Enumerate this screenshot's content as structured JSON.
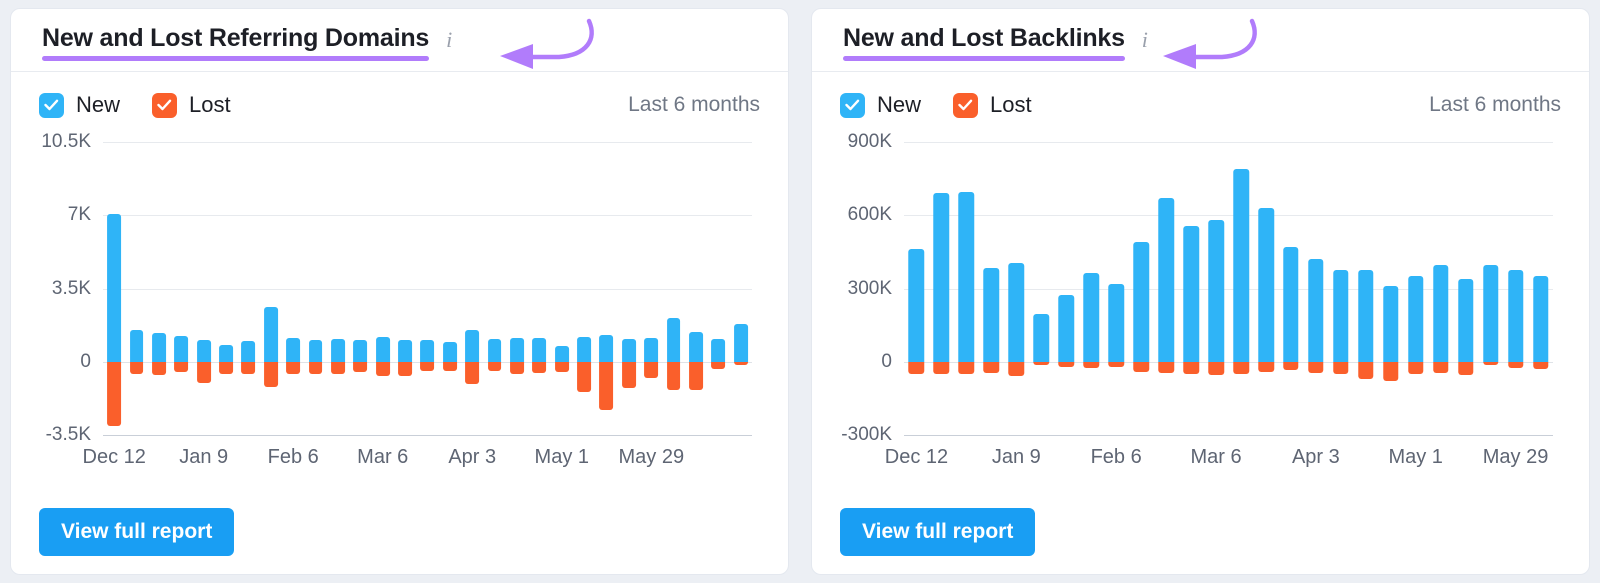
{
  "background_color": "#eceff4",
  "accent": {
    "new": "#2fb4f7",
    "lost": "#fa5f2b",
    "button": "#199ef3",
    "annotation": "#b17cfb"
  },
  "cards": [
    {
      "title": "New and Lost Referring Domains",
      "info_icon": "info-icon",
      "annotation_arrow": "curved-arrow-pointing-left",
      "legend": {
        "new_label": "New",
        "lost_label": "Lost",
        "new_checked": true,
        "lost_checked": true
      },
      "range_label": "Last 6 months",
      "button_label": "View full report",
      "chart_data": {
        "type": "bar",
        "title": "New and Lost Referring Domains",
        "subtitle": "Last 6 months",
        "xlabel": "",
        "ylabel": "",
        "stacked": "diverging",
        "grid": true,
        "legend_position": "top-left",
        "ylim": [
          -3500,
          10500
        ],
        "yticks": [
          10500,
          7000,
          3500,
          0,
          -3500
        ],
        "ytick_labels": [
          "10.5K",
          "7K",
          "3.5K",
          "0",
          "-3.5K"
        ],
        "xtick_labels": [
          "Dec 12",
          "Jan 9",
          "Feb 6",
          "Mar 6",
          "Apr 3",
          "May 1",
          "May 29"
        ],
        "xtick_indices": [
          0,
          4,
          8,
          12,
          16,
          20,
          24
        ],
        "series": [
          {
            "name": "New",
            "color": "#2fb4f7",
            "values": [
              7050,
              1500,
              1350,
              1250,
              1050,
              800,
              1000,
              2600,
              1150,
              1050,
              1100,
              1050,
              1200,
              1050,
              1050,
              950,
              1500,
              1100,
              1150,
              1150,
              750,
              1200,
              1300,
              1100,
              1150,
              2100,
              1400,
              1100,
              1800
            ]
          },
          {
            "name": "Lost",
            "color": "#fa5f2b",
            "values": [
              -3050,
              -600,
              -650,
              -500,
              -1000,
              -600,
              -600,
              -1200,
              -600,
              -600,
              -600,
              -500,
              -700,
              -700,
              -450,
              -450,
              -1050,
              -450,
              -600,
              -550,
              -500,
              -1450,
              -2300,
              -1250,
              -800,
              -1350,
              -1350,
              -350,
              -150
            ]
          }
        ]
      }
    },
    {
      "title": "New and Lost Backlinks",
      "info_icon": "info-icon",
      "annotation_arrow": "curved-arrow-pointing-left",
      "legend": {
        "new_label": "New",
        "lost_label": "Lost",
        "new_checked": true,
        "lost_checked": true
      },
      "range_label": "Last 6 months",
      "button_label": "View full report",
      "chart_data": {
        "type": "bar",
        "title": "New and Lost Backlinks",
        "subtitle": "Last 6 months",
        "xlabel": "",
        "ylabel": "",
        "stacked": "diverging",
        "grid": true,
        "legend_position": "top-left",
        "ylim": [
          -300000,
          900000
        ],
        "yticks": [
          900000,
          600000,
          300000,
          0,
          -300000
        ],
        "ytick_labels": [
          "900K",
          "600K",
          "300K",
          "0",
          "-300K"
        ],
        "xtick_labels": [
          "Dec 12",
          "Jan 9",
          "Feb 6",
          "Mar 6",
          "Apr 3",
          "May 1",
          "May 29"
        ],
        "xtick_indices": [
          0,
          4,
          8,
          12,
          16,
          20,
          24
        ],
        "series": [
          {
            "name": "New",
            "color": "#2fb4f7",
            "values": [
              460000,
              690000,
              695000,
              385000,
              405000,
              195000,
              275000,
              365000,
              320000,
              490000,
              670000,
              555000,
              580000,
              790000,
              630000,
              470000,
              420000,
              375000,
              375000,
              310000,
              350000,
              395000,
              340000,
              395000,
              375000,
              350000
            ]
          },
          {
            "name": "Lost",
            "color": "#fa5f2b",
            "values": [
              -50000,
              -50000,
              -50000,
              -45000,
              -60000,
              -15000,
              -20000,
              -25000,
              -20000,
              -40000,
              -45000,
              -50000,
              -55000,
              -50000,
              -40000,
              -35000,
              -45000,
              -50000,
              -70000,
              -80000,
              -50000,
              -45000,
              -55000,
              -15000,
              -25000,
              -30000
            ]
          }
        ]
      }
    }
  ]
}
